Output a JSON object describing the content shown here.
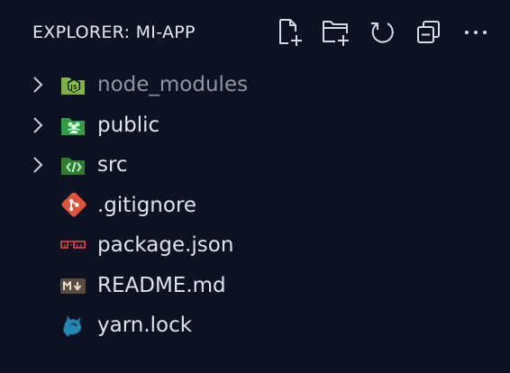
{
  "explorer": {
    "title": "EXPLORER: MI-APP",
    "actions": [
      {
        "name": "new-file-icon",
        "tooltip": "New File"
      },
      {
        "name": "new-folder-icon",
        "tooltip": "New Folder"
      },
      {
        "name": "refresh-icon",
        "tooltip": "Refresh Explorer"
      },
      {
        "name": "collapse-all-icon",
        "tooltip": "Collapse Folders in Explorer"
      },
      {
        "name": "more-actions-icon",
        "tooltip": "More Actions..."
      }
    ],
    "items": [
      {
        "label": "node_modules",
        "type": "folder",
        "icon": "folder-node-icon",
        "dimmed": true,
        "expanded": false
      },
      {
        "label": "public",
        "type": "folder",
        "icon": "folder-public-icon",
        "dimmed": false,
        "expanded": false
      },
      {
        "label": "src",
        "type": "folder",
        "icon": "folder-src-icon",
        "dimmed": false,
        "expanded": false
      },
      {
        "label": ".gitignore",
        "type": "file",
        "icon": "git-icon"
      },
      {
        "label": "package.json",
        "type": "file",
        "icon": "npm-icon"
      },
      {
        "label": "README.md",
        "type": "file",
        "icon": "markdown-icon"
      },
      {
        "label": "yarn.lock",
        "type": "file",
        "icon": "yarn-icon"
      }
    ],
    "colors": {
      "background": "#0c1222",
      "text": "#dfe4eb",
      "dimmed_text": "#8f96a3",
      "folder_green": "#2f9e44",
      "node_green": "#7cb342",
      "git_red": "#e0533a",
      "npm_red": "#c3393a",
      "yarn_blue": "#2188b6"
    }
  }
}
